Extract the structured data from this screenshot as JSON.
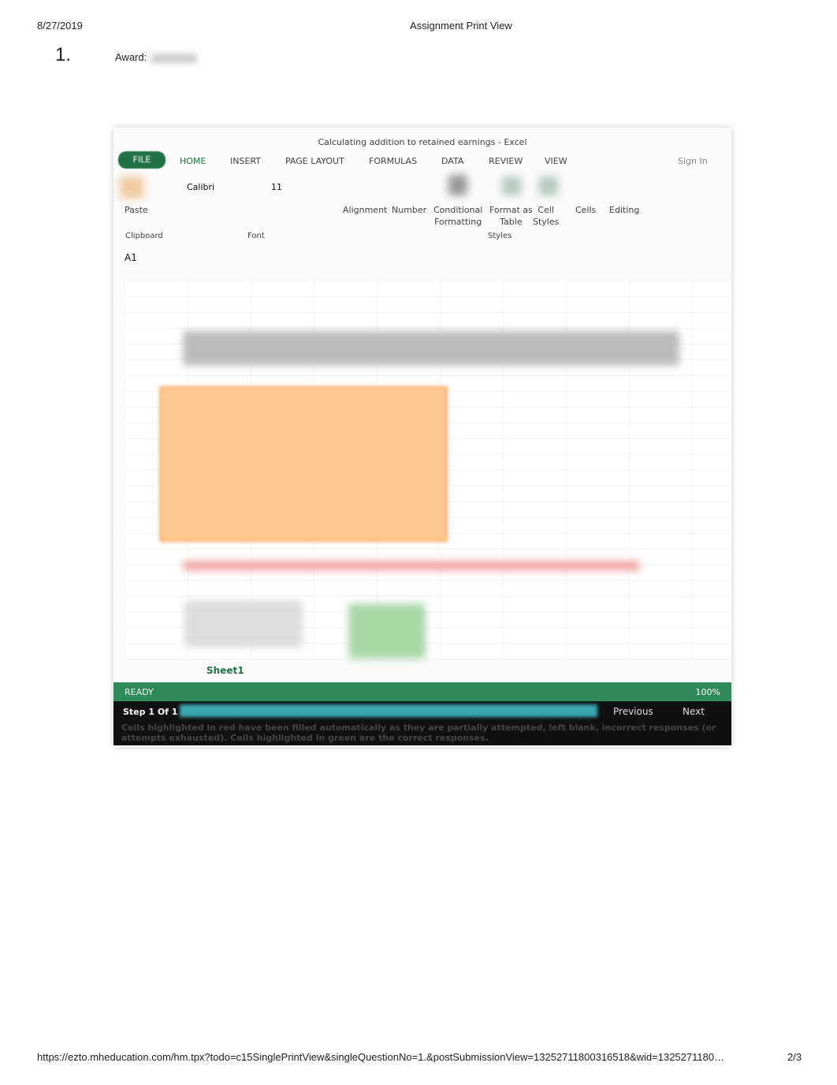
{
  "header": {
    "date": "8/27/2019",
    "title": "Assignment Print View"
  },
  "question": {
    "number": "1.",
    "award_label": "Award:"
  },
  "excel": {
    "window_title": "Calculating addition to retained earnings - Excel",
    "tabs": [
      "FILE",
      "HOME",
      "INSERT",
      "PAGE LAYOUT",
      "FORMULAS",
      "DATA",
      "REVIEW",
      "VIEW"
    ],
    "sign_in": "Sign In",
    "font_name": "Calibri",
    "font_size": "11",
    "ribbon": {
      "paste": "Paste",
      "alignment": "Alignment",
      "number": "Number",
      "conditional": [
        "Conditional",
        "Formatting"
      ],
      "format_table": [
        "Format as",
        "Table"
      ],
      "cell_styles": [
        "Cell",
        "Styles"
      ],
      "cells": "Cells",
      "editing": "Editing"
    },
    "groups": {
      "clipboard": "Clipboard",
      "font": "Font",
      "styles": "Styles"
    },
    "name_box": "A1",
    "sheet_tab": "Sheet1",
    "status": "READY",
    "zoom": "100%",
    "step": "Step 1 Of 1",
    "previous": "Previous",
    "next": "Next",
    "message": "Cells highlighted in red have been filled automatically as they are partially attempted, left blank, incorrect responses (or attempts exhausted). Cells highlighted in green are the correct responses.",
    "colors": {
      "file_tab": "#217346",
      "status_bar": "#2e8a58",
      "message": "#43b7c8",
      "highlight": "#ffc890"
    }
  },
  "footer": {
    "url": "https://ezto.mheducation.com/hm.tpx?todo=c15SinglePrintView&singleQuestionNo=1.&postSubmissionView=13252711800316518&wid=1325271180…",
    "page": "2/3"
  }
}
